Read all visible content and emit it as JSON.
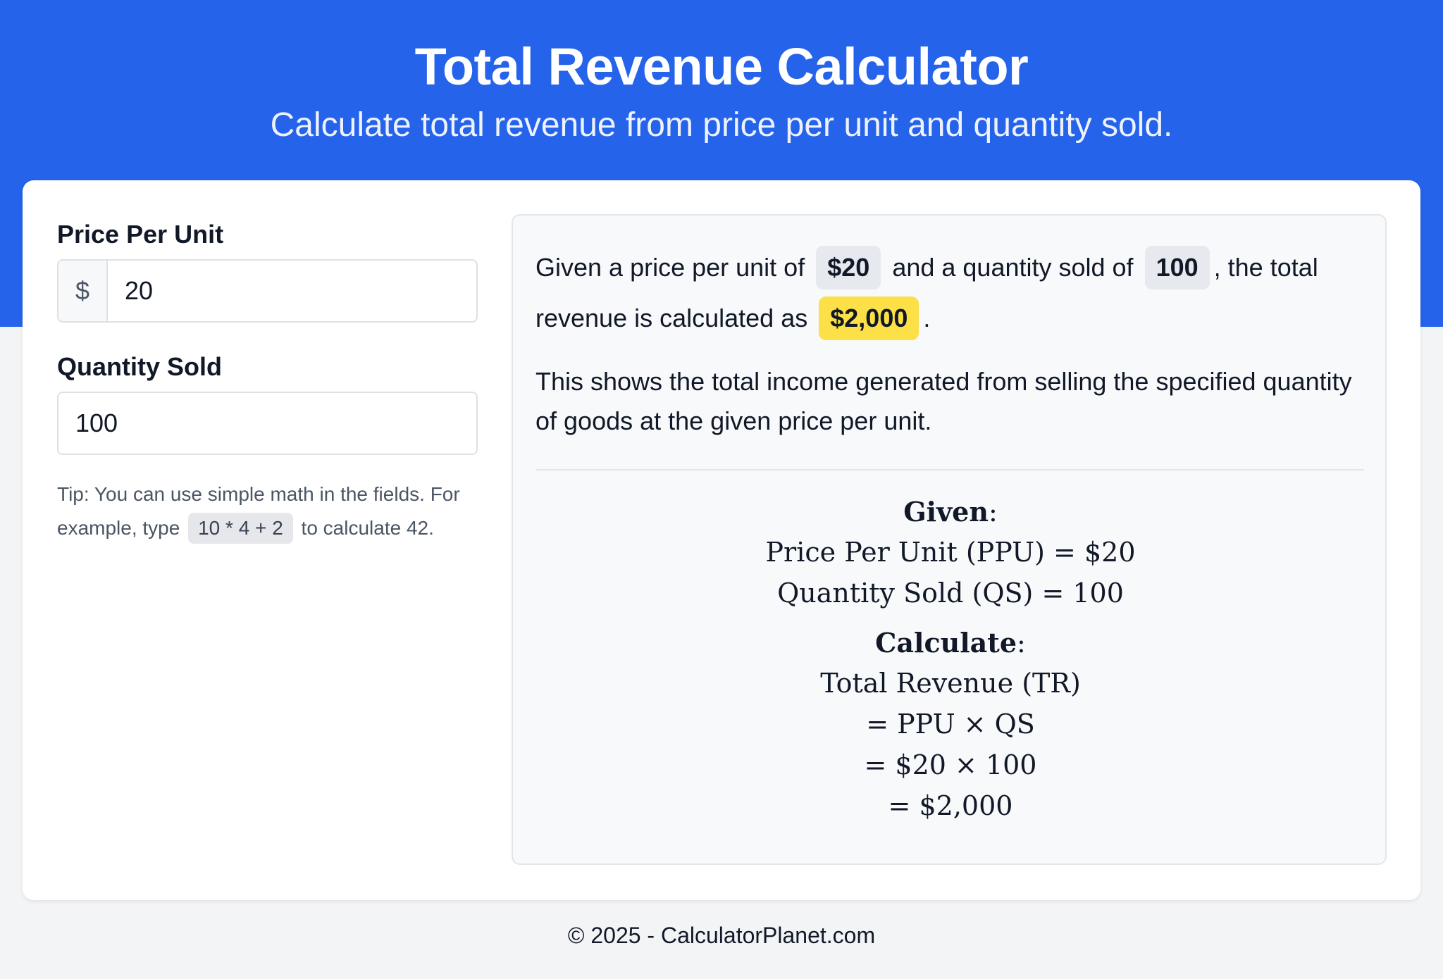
{
  "header": {
    "title": "Total Revenue Calculator",
    "subtitle": "Calculate total revenue from price per unit and quantity sold."
  },
  "form": {
    "price_label": "Price Per Unit",
    "price_prefix": "$",
    "price_value": "20",
    "quantity_label": "Quantity Sold",
    "quantity_value": "100",
    "tip_text_1": "Tip: You can use simple math in the fields. For example, type",
    "tip_code": "10 * 4 + 2",
    "tip_text_2": "to calculate 42."
  },
  "result": {
    "s1": "Given a price per unit of",
    "price_chip": "$20",
    "s2": "and a quantity sold of",
    "quantity_chip": "100",
    "s3": ", the total revenue is calculated as",
    "total_chip": "$2,000",
    "s4": ".",
    "description": "This shows the total income generated from selling the specified quantity of goods at the given price per unit.",
    "math": {
      "given_heading": "Given",
      "given_line_1": "Price Per Unit (PPU) = $20",
      "given_line_2": "Quantity Sold (QS) = 100",
      "calc_heading": "Calculate",
      "calc_line_1": "Total Revenue (TR)",
      "calc_line_2": "= PPU × QS",
      "calc_line_3": "= $20 × 100",
      "calc_line_4": "= $2,000"
    }
  },
  "footer": {
    "text": "© 2025 - CalculatorPlanet.com"
  },
  "colors": {
    "brand": "#2563eb",
    "highlight": "#fde047"
  }
}
